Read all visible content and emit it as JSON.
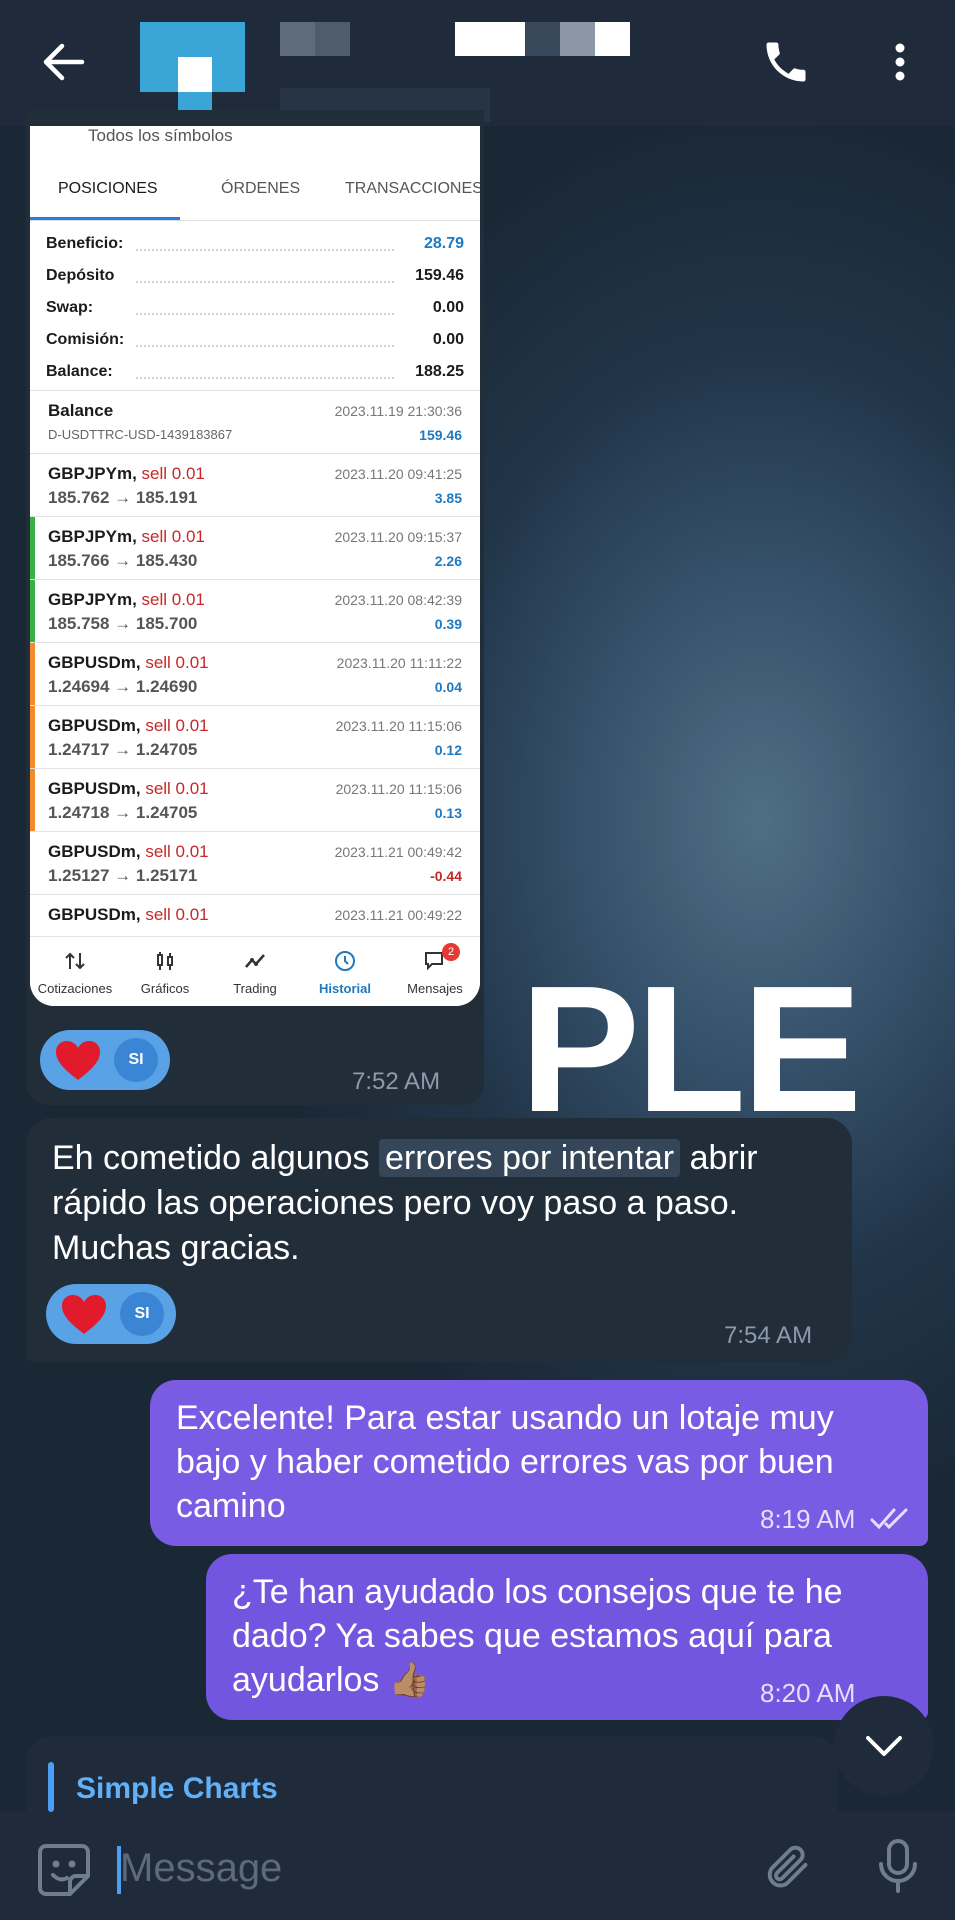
{
  "header": {
    "back_icon": "arrow-left-icon",
    "call_icon": "phone-icon",
    "more_icon": "more-vertical-icon"
  },
  "watermark": "PLE",
  "screenshot": {
    "top_text": "Todos los símbolos",
    "tabs": [
      "POSICIONES",
      "ÓRDENES",
      "TRANSACCIONES"
    ],
    "summary": [
      {
        "label": "Beneficio:",
        "value": "28.79",
        "highlight": true
      },
      {
        "label": "Depósito",
        "value": "159.46"
      },
      {
        "label": "Swap:",
        "value": "0.00"
      },
      {
        "label": "Comisión:",
        "value": "0.00"
      },
      {
        "label": "Balance:",
        "value": "188.25"
      }
    ],
    "balance_row": {
      "title": "Balance",
      "sub": "D-USDTTRC-USD-1439183867",
      "time": "2023.11.19 21:30:36",
      "value": "159.46"
    },
    "trades": [
      {
        "symbol": "GBPJPYm,",
        "side": "sell 0.01",
        "prices": "185.762 → 185.191",
        "time": "2023.11.20 09:41:25",
        "pl": "3.85",
        "bar": ""
      },
      {
        "symbol": "GBPJPYm,",
        "side": "sell 0.01",
        "prices": "185.766 → 185.430",
        "time": "2023.11.20 09:15:37",
        "pl": "2.26",
        "bar": "#3cb043"
      },
      {
        "symbol": "GBPJPYm,",
        "side": "sell 0.01",
        "prices": "185.758 → 185.700",
        "time": "2023.11.20 08:42:39",
        "pl": "0.39",
        "bar": "#3cb043"
      },
      {
        "symbol": "GBPUSDm,",
        "side": "sell 0.01",
        "prices": "1.24694 → 1.24690",
        "time": "2023.11.20 11:11:22",
        "pl": "0.04",
        "bar": "#f08c2c"
      },
      {
        "symbol": "GBPUSDm,",
        "side": "sell 0.01",
        "prices": "1.24717 → 1.24705",
        "time": "2023.11.20 11:15:06",
        "pl": "0.12",
        "bar": "#f08c2c"
      },
      {
        "symbol": "GBPUSDm,",
        "side": "sell 0.01",
        "prices": "1.24718 → 1.24705",
        "time": "2023.11.20 11:15:06",
        "pl": "0.13",
        "bar": "#f08c2c"
      },
      {
        "symbol": "GBPUSDm,",
        "side": "sell 0.01",
        "prices": "1.25127 → 1.25171",
        "time": "2023.11.21 00:49:42",
        "pl": "-0.44",
        "bar": ""
      },
      {
        "symbol": "GBPUSDm,",
        "side": "sell 0.01",
        "prices": "",
        "time": "2023.11.21 00:49:22",
        "pl": "",
        "bar": ""
      }
    ],
    "nav": [
      {
        "label": "Cotizaciones",
        "icon": "quotes-icon"
      },
      {
        "label": "Gráficos",
        "icon": "charts-icon"
      },
      {
        "label": "Trading",
        "icon": "trading-icon"
      },
      {
        "label": "Historial",
        "icon": "history-icon",
        "active": true
      },
      {
        "label": "Mensajes",
        "icon": "messages-icon",
        "badge": "2"
      }
    ]
  },
  "messages": [
    {
      "reaction_label": "SI",
      "time": "7:52 AM"
    },
    {
      "text_before": "Eh cometido algunos ",
      "text_highlight": "errores por intentar",
      "text_after": " abrir",
      "line2": "rápido las operaciones pero voy paso a paso.",
      "line3": "Muchas gracias.",
      "reaction_label": "SI",
      "time": "7:54 AM"
    },
    {
      "line1": "Excelente! Para estar usando un lotaje muy",
      "line2": "bajo y haber cometido errores vas por buen",
      "line3": "camino",
      "time": "8:19 AM"
    },
    {
      "line1": "¿Te han ayudado los consejos que te he",
      "line2": "dado?  Ya sabes que estamos aquí para",
      "line3": "ayudarlos 👍🏽",
      "time": "8:20 AM"
    }
  ],
  "reply_preview": {
    "title": "Simple Charts"
  },
  "composer": {
    "placeholder": "Message"
  },
  "colors": {
    "header_bg": "#1f2b3a",
    "incoming_bubble": "#222d3a",
    "outgoing_bubble": "#7a5be3",
    "accent_blue": "#4c9ff2"
  }
}
